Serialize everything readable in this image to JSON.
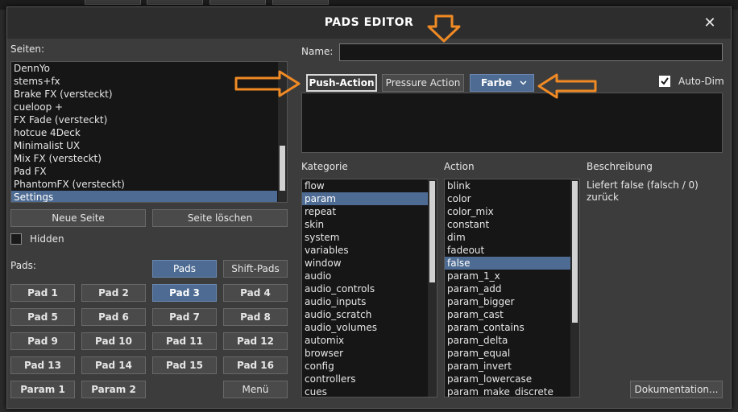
{
  "dialog": {
    "title": "PADS EDITOR",
    "close_symbol": "✕"
  },
  "left": {
    "pages_label": "Seiten:",
    "pages": [
      "DennYo",
      "stems+fx",
      "Brake FX (versteckt)",
      "cueloop +",
      "FX Fade (versteckt)",
      "hotcue 4Deck",
      "Minimalist UX",
      "Mix FX (versteckt)",
      "Pad FX",
      "PhantomFX (versteckt)",
      "Settings"
    ],
    "selected_page": "Settings",
    "new_page_label": "Neue Seite",
    "delete_page_label": "Seite löschen",
    "hidden_label": "Hidden",
    "hidden_checked": false,
    "pads_label": "Pads:",
    "pads_tab_label": "Pads",
    "shift_pads_label": "Shift-Pads",
    "pads": [
      "Pad 1",
      "Pad 2",
      "Pad 3",
      "Pad 4",
      "Pad 5",
      "Pad 6",
      "Pad 7",
      "Pad 8",
      "Pad 9",
      "Pad 10",
      "Pad 11",
      "Pad 12",
      "Pad 13",
      "Pad 14",
      "Pad 15",
      "Pad 16"
    ],
    "selected_pad": "Pad 3",
    "param1_label": "Param 1",
    "param2_label": "Param 2",
    "menu_label": "Menü"
  },
  "right": {
    "name_label": "Name:",
    "name_value": "",
    "tab_push": "Push-Action",
    "tab_pressure": "Pressure Action",
    "color_label": "Farbe",
    "auto_dim_label": "Auto-Dim",
    "auto_dim_checked": true,
    "script_value": "",
    "category_header": "Kategorie",
    "action_header": "Action",
    "description_header": "Beschreibung",
    "categories": [
      "flow",
      "param",
      "repeat",
      "skin",
      "system",
      "variables",
      "window",
      "audio",
      "audio_controls",
      "audio_inputs",
      "audio_scratch",
      "audio_volumes",
      "automix",
      "browser",
      "config",
      "controllers",
      "cues"
    ],
    "selected_category": "param",
    "actions": [
      "blink",
      "color",
      "color_mix",
      "constant",
      "dim",
      "fadeout",
      "false",
      "param_1_x",
      "param_add",
      "param_bigger",
      "param_cast",
      "param_contains",
      "param_delta",
      "param_equal",
      "param_invert",
      "param_lowercase",
      "param_make_discrete"
    ],
    "selected_action": "false",
    "description": "Liefert false (falsch / 0) zurück",
    "doc_button_label": "Dokumentation..."
  },
  "colors": {
    "accent": "#4e6c93",
    "arrow": "#f08a24",
    "list_bg": "#161616",
    "dialog_bg": "#3c3c3c"
  }
}
